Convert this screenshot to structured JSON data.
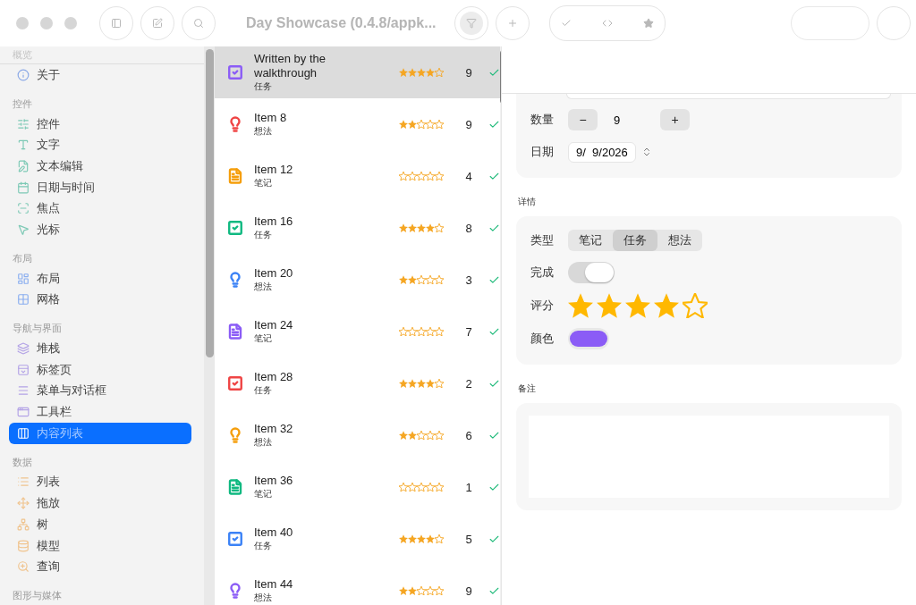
{
  "window": {
    "title": "Day Showcase (0.4.8/appk..."
  },
  "sidebar": {
    "sections": [
      {
        "title": "概览",
        "items": [
          {
            "label": "关于",
            "selected": false
          }
        ]
      },
      {
        "title": "控件",
        "items": [
          {
            "label": "控件",
            "selected": false
          },
          {
            "label": "文字",
            "selected": false
          },
          {
            "label": "文本编辑",
            "selected": false
          },
          {
            "label": "日期与时间",
            "selected": false
          },
          {
            "label": "焦点",
            "selected": false
          },
          {
            "label": "光标",
            "selected": false
          }
        ]
      },
      {
        "title": "布局",
        "items": [
          {
            "label": "布局",
            "selected": false
          },
          {
            "label": "网格",
            "selected": false
          }
        ]
      },
      {
        "title": "导航与界面",
        "items": [
          {
            "label": "堆栈",
            "selected": false
          },
          {
            "label": "标签页",
            "selected": false
          },
          {
            "label": "菜单与对话框",
            "selected": false
          },
          {
            "label": "工具栏",
            "selected": false
          },
          {
            "label": "内容列表",
            "selected": true
          }
        ]
      },
      {
        "title": "数据",
        "items": [
          {
            "label": "列表",
            "selected": false
          },
          {
            "label": "拖放",
            "selected": false
          },
          {
            "label": "树",
            "selected": false
          },
          {
            "label": "模型",
            "selected": false
          },
          {
            "label": "查询",
            "selected": false
          }
        ]
      },
      {
        "title": "图形与媒体"
      }
    ]
  },
  "list": {
    "rows": [
      {
        "kind": "task",
        "color": "#8b5cf6",
        "title": "Written by the walkthrough",
        "type": "任务",
        "stars": 4,
        "count": "9",
        "done": true,
        "selected": true
      },
      {
        "kind": "idea",
        "color": "#ef4444",
        "title": "Item 8",
        "type": "想法",
        "stars": 2,
        "count": "9",
        "done": true,
        "selected": false
      },
      {
        "kind": "note",
        "color": "#f59e0b",
        "title": "Item 12",
        "type": "笔记",
        "stars": 0,
        "count": "4",
        "done": true,
        "selected": false
      },
      {
        "kind": "task",
        "color": "#10b981",
        "title": "Item 16",
        "type": "任务",
        "stars": 4,
        "count": "8",
        "done": true,
        "selected": false
      },
      {
        "kind": "idea",
        "color": "#3b82f6",
        "title": "Item 20",
        "type": "想法",
        "stars": 2,
        "count": "3",
        "done": true,
        "selected": false
      },
      {
        "kind": "note",
        "color": "#8b5cf6",
        "title": "Item 24",
        "type": "笔记",
        "stars": 0,
        "count": "7",
        "done": true,
        "selected": false
      },
      {
        "kind": "task",
        "color": "#ef4444",
        "title": "Item 28",
        "type": "任务",
        "stars": 4,
        "count": "2",
        "done": true,
        "selected": false
      },
      {
        "kind": "idea",
        "color": "#f59e0b",
        "title": "Item 32",
        "type": "想法",
        "stars": 2,
        "count": "6",
        "done": true,
        "selected": false
      },
      {
        "kind": "note",
        "color": "#10b981",
        "title": "Item 36",
        "type": "笔记",
        "stars": 0,
        "count": "1",
        "done": true,
        "selected": false
      },
      {
        "kind": "task",
        "color": "#3b82f6",
        "title": "Item 40",
        "type": "任务",
        "stars": 4,
        "count": "5",
        "done": true,
        "selected": false
      },
      {
        "kind": "idea",
        "color": "#8b5cf6",
        "title": "Item 44",
        "type": "想法",
        "stars": 2,
        "count": "9",
        "done": true,
        "selected": false
      }
    ]
  },
  "detail": {
    "quantity": {
      "label": "数量",
      "minus": "−",
      "value": "9",
      "plus": "+"
    },
    "date": {
      "label": "日期",
      "value": "9/  9/2026"
    },
    "details_title": "详情",
    "type": {
      "label": "类型",
      "options": [
        {
          "label": "笔记",
          "selected": false
        },
        {
          "label": "任务",
          "selected": true
        },
        {
          "label": "想法",
          "selected": false
        }
      ]
    },
    "done": {
      "label": "完成",
      "on": true
    },
    "rating": {
      "label": "评分",
      "stars": 4
    },
    "color": {
      "label": "颜色",
      "color": "#8b5cf6"
    },
    "notes_title": "备注"
  }
}
